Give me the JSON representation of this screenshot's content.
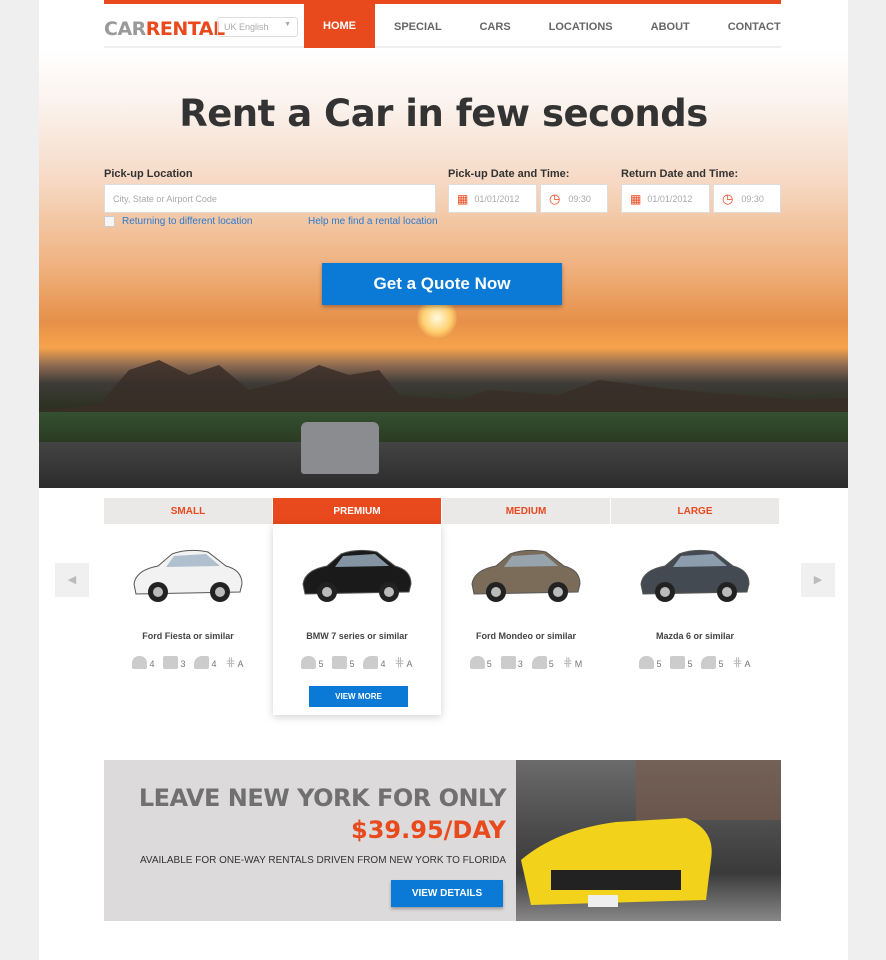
{
  "brand": {
    "part1": "CAR",
    "part2": "RENTAL"
  },
  "language": {
    "selected": "UK English"
  },
  "nav": [
    {
      "label": "HOME",
      "active": true
    },
    {
      "label": "SPECIAL OFFERS"
    },
    {
      "label": "CARS"
    },
    {
      "label": "LOCATIONS"
    },
    {
      "label": "ABOUT"
    },
    {
      "label": "CONTACT"
    }
  ],
  "hero": {
    "title": "Rent a Car in few seconds",
    "pickup_location_label": "Pick-up Location",
    "pickup_location_placeholder": "City, State or Airport Code",
    "returning_label": "Returning to different location",
    "help_link": "Help me find a rental location",
    "pickup_datetime_label": "Pick-up Date and Time:",
    "pickup_date": "01/01/2012",
    "pickup_time": "09:30",
    "return_datetime_label": "Return Date and Time:",
    "return_date": "01/01/2012",
    "return_time": "09:30",
    "quote_button": "Get a Quote Now"
  },
  "cars": [
    {
      "category": "SMALL",
      "name": "Ford Fiesta or similar",
      "passengers": "4",
      "bags": "3",
      "doors": "4",
      "transmission": "A",
      "color": "#f2f2f2"
    },
    {
      "category": "PREMIUM",
      "name": "BMW 7 series or similar",
      "passengers": "5",
      "bags": "5",
      "doors": "4",
      "transmission": "A",
      "active": true,
      "view_more": "VIEW MORE",
      "color": "#1a1a1a"
    },
    {
      "category": "MEDIUM",
      "name": "Ford Mondeo or similar",
      "passengers": "5",
      "bags": "3",
      "doors": "5",
      "transmission": "M",
      "color": "#7a6c58"
    },
    {
      "category": "LARGE",
      "name": "Mazda 6 or similar",
      "passengers": "5",
      "bags": "5",
      "doors": "5",
      "transmission": "A",
      "color": "#444a52"
    }
  ],
  "promo": {
    "title": "LEAVE NEW YORK FOR ONLY",
    "price": "$39.95/DAY",
    "subtitle": "AVAILABLE FOR ONE-WAY RENTALS DRIVEN FROM NEW YORK TO FLORIDA",
    "button": "VIEW DETAILS"
  },
  "colors": {
    "accent": "#e8491d",
    "button": "#0b7ad6"
  }
}
